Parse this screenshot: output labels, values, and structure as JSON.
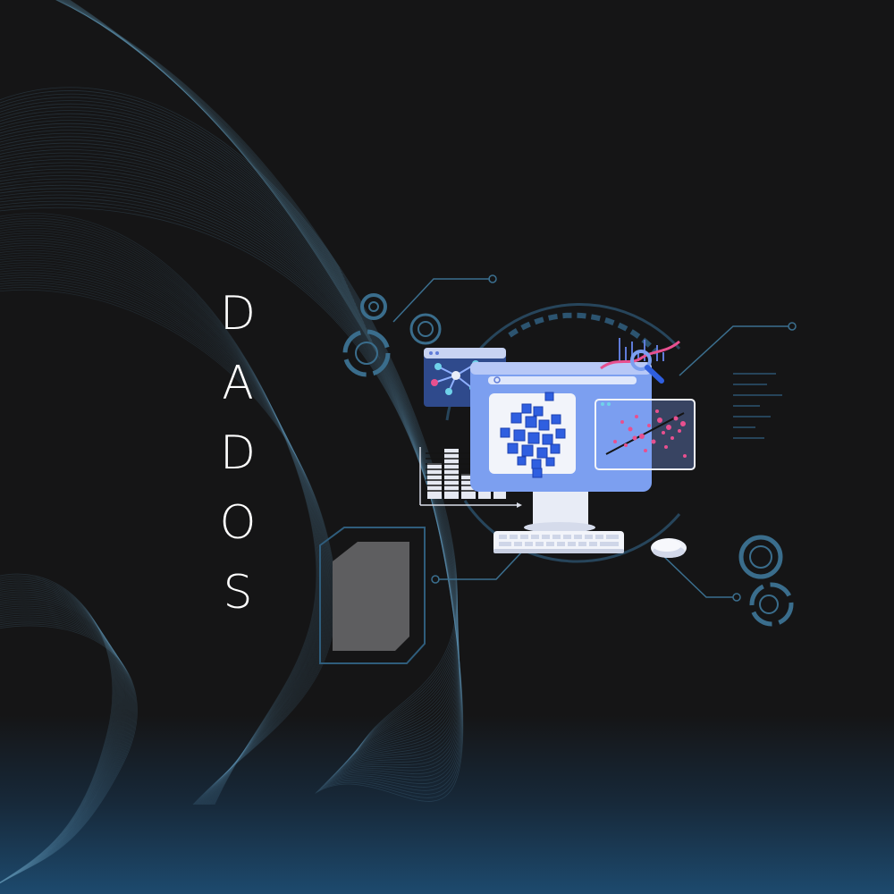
{
  "title_letters": [
    "D",
    "A",
    "D",
    "O",
    "S"
  ],
  "colors": {
    "background": "#151516",
    "bottom_glow": "#1d4a6e",
    "wave_lines": "#5d8fae",
    "circuit_lines": "#3b6f8f",
    "monitor_blue": "#7c9ff0",
    "cube_blue": "#2f5fe0",
    "accent_pink": "#e8508f"
  },
  "icons": [
    "wave-pattern",
    "monitor-icon",
    "data-cube-icon",
    "network-graph-icon",
    "bar-chart-icon",
    "scatter-plot-icon",
    "magnifier-icon",
    "keyboard-icon",
    "mouse-icon",
    "gear-ring-icon",
    "circuit-lines"
  ]
}
